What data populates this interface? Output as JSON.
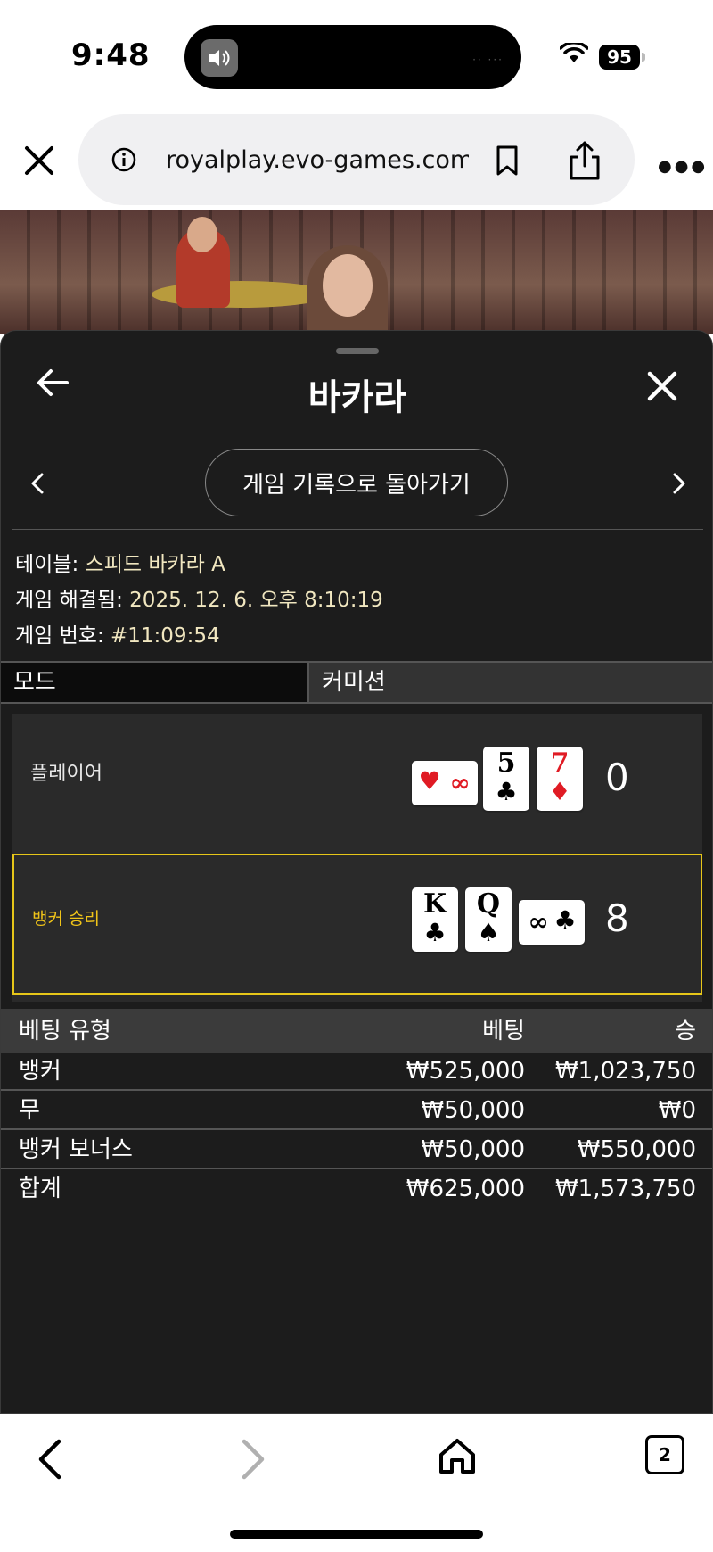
{
  "status_bar": {
    "time": "9:48",
    "battery": "95"
  },
  "browser": {
    "url": "royalplay.evo-games.com",
    "tab_count": "2"
  },
  "panel": {
    "title": "바카라",
    "back_to_history": "게임 기록으로 돌아가기",
    "info": [
      {
        "label": "테이블: ",
        "value": "스피드 바카라 A"
      },
      {
        "label": "게임 해결됨: ",
        "value": "2025. 12. 6. 오후 8:10:19"
      },
      {
        "label": "게임 번호: ",
        "value": "#11:09:54"
      }
    ],
    "mode": {
      "label": "모드",
      "value": "커미션"
    }
  },
  "hands": {
    "player": {
      "label": "플레이어",
      "score": "0",
      "cards": [
        {
          "rank": "∞",
          "suit": "♥",
          "color": "red",
          "orientation": "sideways"
        },
        {
          "rank": "5",
          "suit": "♣",
          "color": "black",
          "orientation": "upright"
        },
        {
          "rank": "7",
          "suit": "♦",
          "color": "red",
          "orientation": "upright"
        }
      ]
    },
    "banker": {
      "label": "뱅커 승리",
      "score": "8",
      "cards": [
        {
          "rank": "K",
          "suit": "♣",
          "color": "black",
          "orientation": "upright"
        },
        {
          "rank": "Q",
          "suit": "♠",
          "color": "black",
          "orientation": "upright"
        },
        {
          "rank": "∞",
          "suit": "♣",
          "color": "black",
          "orientation": "sideways"
        }
      ]
    },
    "highlight_color": "#e6c619"
  },
  "bets": {
    "headers": {
      "type": "베팅 유형",
      "bet": "베팅",
      "win": "승"
    },
    "rows": [
      {
        "type": "뱅커",
        "bet": "₩525,000",
        "win": "₩1,023,750"
      },
      {
        "type": "무",
        "bet": "₩50,000",
        "win": "₩0"
      },
      {
        "type": "뱅커 보너스",
        "bet": "₩50,000",
        "win": "₩550,000"
      }
    ],
    "total": {
      "type": "합계",
      "bet": "₩625,000",
      "win": "₩1,573,750"
    }
  }
}
